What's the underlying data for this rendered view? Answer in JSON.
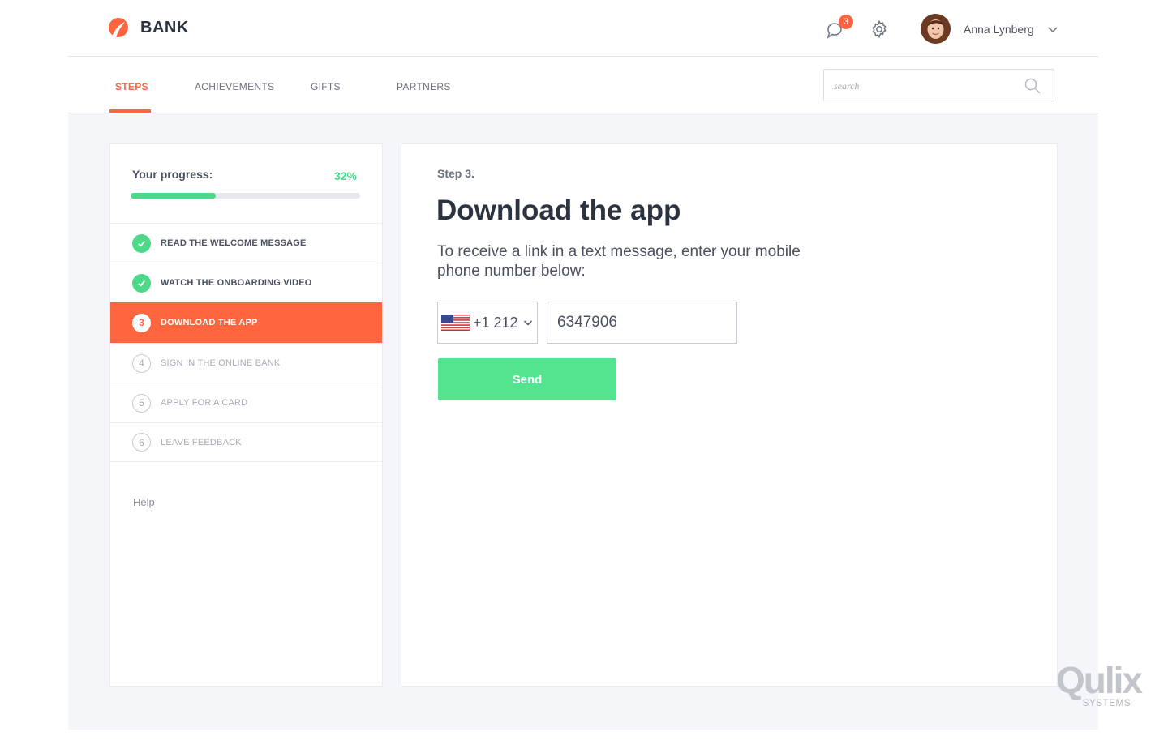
{
  "header": {
    "brand_name": "BANK",
    "notifications_count": "3",
    "user_name": "Anna Lynberg"
  },
  "nav": {
    "tabs": [
      {
        "label": "STEPS",
        "active": true
      },
      {
        "label": "ACHIEVEMENTS",
        "active": false
      },
      {
        "label": "GIFTS",
        "active": false
      },
      {
        "label": "PARTNERS",
        "active": false
      }
    ],
    "search_placeholder": "search"
  },
  "sidebar": {
    "progress_label": "Your progress:",
    "progress_text": "32%",
    "progress_value": 0.37,
    "steps": [
      {
        "label": "READ THE WELCOME MESSAGE",
        "status": "done",
        "number": ""
      },
      {
        "label": "WATCH THE ONBOARDING VIDEO",
        "status": "done",
        "number": ""
      },
      {
        "label": "DOWNLOAD THE APP",
        "status": "current",
        "number": "3"
      },
      {
        "label": "SIGN IN THE ONLINE BANK",
        "status": "todo",
        "number": "4"
      },
      {
        "label": "APPLY FOR A CARD",
        "status": "todo",
        "number": "5"
      },
      {
        "label": "LEAVE FEEDBACK",
        "status": "todo",
        "number": "6"
      }
    ],
    "help_label": "Help"
  },
  "panel": {
    "step_number": "Step 3.",
    "title": "Download the app",
    "description": "To receive a link in a text message, enter your mobile phone number below:",
    "country_code": "+1 212",
    "phone_value": "6347906",
    "send_label": "Send"
  },
  "watermark": {
    "main": "Qulix",
    "sub": "SYSTEMS"
  },
  "colors": {
    "accent": "#ff6640",
    "success": "#4cd98a",
    "send_button": "#54e38f",
    "background": "#f5f6fa"
  }
}
